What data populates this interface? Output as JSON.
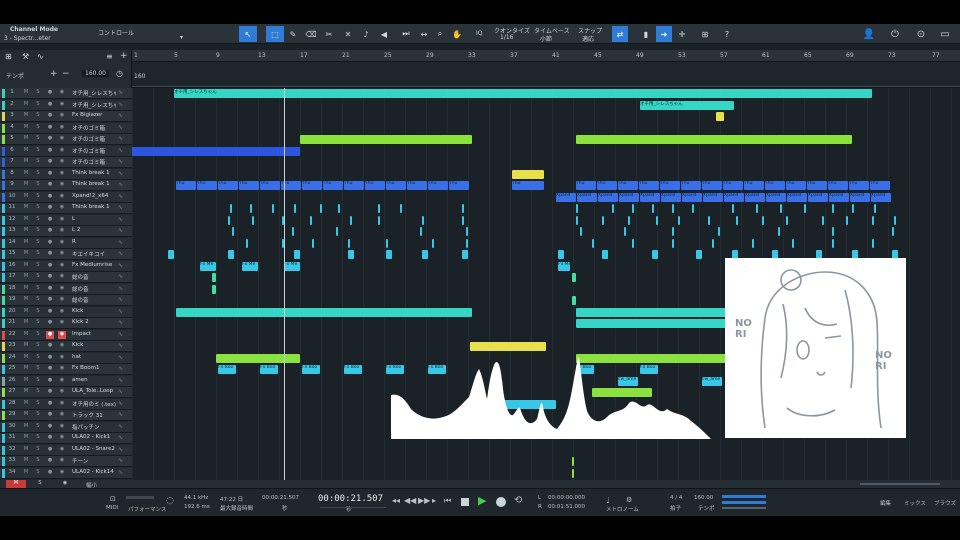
{
  "header": {
    "mode_title": "Channel Mode",
    "channel_name": "3 - Spectr...eter",
    "control_label": "コントロール"
  },
  "toolbar": {
    "quantize_label": "クオンタイズ",
    "quantize_value": "1/16",
    "timebase_label": "タイムベース",
    "timebase_value": "小節",
    "snap_label": "スナップ",
    "snap_value": "適応",
    "iq_label": "IQ",
    "help_label": "?"
  },
  "ruler": {
    "bars": [
      "1",
      "5",
      "9",
      "13",
      "17",
      "21",
      "25",
      "29",
      "33",
      "37",
      "41",
      "45",
      "49",
      "53",
      "57",
      "61",
      "65",
      "69",
      "73",
      "77"
    ],
    "tempo_label": "テンポ",
    "tempo_value": "160.00",
    "tempo_lane_value": "160"
  },
  "tracks": [
    {
      "num": "1",
      "name": "オチ用_シレスちゃん",
      "color": "#3ad1c1"
    },
    {
      "num": "2",
      "name": "オチ用_シレスちゃん 2",
      "color": "#3ad1c1"
    },
    {
      "num": "3",
      "name": "Fx Biglazer",
      "color": "#e6d84a"
    },
    {
      "num": "4",
      "name": "オチのゴミ箱",
      "color": "#8ee04a"
    },
    {
      "num": "5",
      "name": "オチのゴミ箱",
      "color": "#8ee04a"
    },
    {
      "num": "6",
      "name": "オチのゴミ箱",
      "color": "#2f5ee0"
    },
    {
      "num": "7",
      "name": "オチのゴミ箱",
      "color": "#2f5ee0"
    },
    {
      "num": "8",
      "name": "Think break 1",
      "color": "#3a74e0"
    },
    {
      "num": "9",
      "name": "Think break 1",
      "color": "#3a74e0"
    },
    {
      "num": "10",
      "name": "Xpand!2_x64",
      "color": "#3a74e0"
    },
    {
      "num": "11",
      "name": "Think break 1",
      "color": "#38c7e0"
    },
    {
      "num": "12",
      "name": "L",
      "color": "#38c7e0"
    },
    {
      "num": "13",
      "name": "L 2",
      "color": "#38c7e0"
    },
    {
      "num": "14",
      "name": "R",
      "color": "#38c7e0"
    },
    {
      "num": "15",
      "name": "キエイキコイ",
      "color": "#38c7e0"
    },
    {
      "num": "16",
      "name": "Fx Mediumrise",
      "color": "#38c7e0"
    },
    {
      "num": "17",
      "name": "総の音",
      "color": "#38c7e0"
    },
    {
      "num": "18",
      "name": "総の音",
      "color": "#3ee09a"
    },
    {
      "num": "19",
      "name": "総の音",
      "color": "#3ee09a"
    },
    {
      "num": "20",
      "name": "Kick",
      "color": "#3ad1c1"
    },
    {
      "num": "21",
      "name": "Kick 2",
      "color": "#3ad1c1"
    },
    {
      "num": "22",
      "name": "Impact",
      "color": "#e04a4a"
    },
    {
      "num": "23",
      "name": "Kick",
      "color": "#e6d84a"
    },
    {
      "num": "24",
      "name": "hat",
      "color": "#8ee04a"
    },
    {
      "num": "25",
      "name": "Fx Boom1",
      "color": "#38c7e0"
    },
    {
      "num": "26",
      "name": "amen",
      "color": "#8ea0ad"
    },
    {
      "num": "27",
      "name": "ULA_Tole..Loop",
      "color": "#8ee04a"
    },
    {
      "num": "28",
      "name": "オチ用のミ (.tex)",
      "color": "#38c7e0"
    },
    {
      "num": "29",
      "name": "トラック 31",
      "color": "#8ee04a"
    },
    {
      "num": "30",
      "name": "指パッチン",
      "color": "#38c7e0"
    },
    {
      "num": "31",
      "name": "ULA02 - Kick1",
      "color": "#38c7e0"
    },
    {
      "num": "32",
      "name": "ULA02 - Snare2",
      "color": "#38c7e0"
    },
    {
      "num": "33",
      "name": "チーン",
      "color": "#38c7e0"
    },
    {
      "num": "34",
      "name": "ULA02 - Kick14",
      "color": "#38c7e0"
    }
  ],
  "clips": {
    "lane0_label": "オチ用_シレスちゃん",
    "lane1_label": "オチ用_シレスちゃん",
    "think": "Thu",
    "xpand": "Xpand",
    "fx_mediumrise": "Fx Me",
    "fx_boom": "Fx Boo",
    "amen_clip": "(no master)",
    "cw": "cw_ame"
  },
  "transport": {
    "midi_label": "MIDI",
    "perf_label": "パフォーマンス",
    "sample_rate": "44.1 kHz",
    "latency": "192.6 ms",
    "rec_time": "47:22 日",
    "rec_time_label": "最大録音時間",
    "position_small": "00:00:21.507",
    "position_small_unit": "秒",
    "position_main": "00:00:21.507",
    "position_main_unit": "秒",
    "loop_start": "00:00:00.000",
    "loop_end": "00:01:51.000",
    "metronome_label": "メトロノーム",
    "signature": "4 / 4",
    "signature_label": "拍子",
    "tempo": "160.00",
    "tempo_label": "テンポ"
  },
  "footer": {
    "edit": "編集",
    "mix": "ミックス",
    "browse": "ブラウズ",
    "zoom_label": "幅小"
  },
  "overlay": {
    "nori_left": "NO RI",
    "nori_right": "NO RI"
  }
}
